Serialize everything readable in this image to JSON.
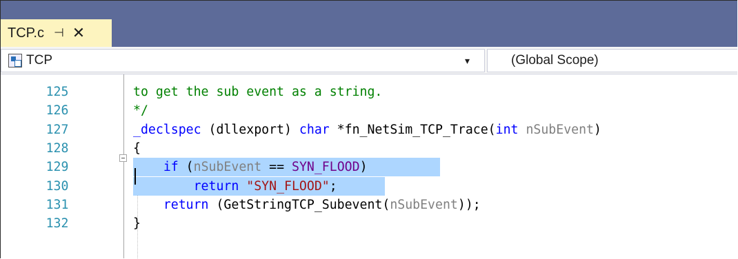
{
  "tab": {
    "title": "TCP.c",
    "pin_glyph": "⊣",
    "close_glyph": "✕"
  },
  "navbar": {
    "project": "TCP",
    "scope": "(Global Scope)",
    "arrow": "▾"
  },
  "editor": {
    "lines": [
      {
        "num": "125",
        "tokens": [
          {
            "text": "to get the sub event as a string.",
            "cls": "cm"
          }
        ]
      },
      {
        "num": "126",
        "tokens": [
          {
            "text": "*/",
            "cls": "cm"
          }
        ]
      },
      {
        "num": "127",
        "tokens": [
          {
            "text": "_declspec",
            "cls": "kw"
          },
          {
            "text": " (dllexport) ",
            "cls": ""
          },
          {
            "text": "char",
            "cls": "kw"
          },
          {
            "text": " *fn_NetSim_TCP_Trace(",
            "cls": ""
          },
          {
            "text": "int",
            "cls": "kw"
          },
          {
            "text": " ",
            "cls": ""
          },
          {
            "text": "nSubEvent",
            "cls": "param"
          },
          {
            "text": ")",
            "cls": ""
          }
        ]
      },
      {
        "num": "128",
        "tokens": [
          {
            "text": "{",
            "cls": ""
          }
        ]
      },
      {
        "num": "129",
        "tokens": [
          {
            "text": "    ",
            "cls": ""
          },
          {
            "text": "if",
            "cls": "kw"
          },
          {
            "text": " (",
            "cls": ""
          },
          {
            "text": "nSubEvent",
            "cls": "param"
          },
          {
            "text": " == ",
            "cls": ""
          },
          {
            "text": "SYN_FLOOD",
            "cls": "macro"
          },
          {
            "text": ")",
            "cls": ""
          }
        ]
      },
      {
        "num": "130",
        "tokens": [
          {
            "text": "        ",
            "cls": ""
          },
          {
            "text": "return",
            "cls": "kw"
          },
          {
            "text": " ",
            "cls": ""
          },
          {
            "text": "\"SYN_FLOOD\"",
            "cls": "str"
          },
          {
            "text": ";",
            "cls": ""
          }
        ]
      },
      {
        "num": "131",
        "tokens": [
          {
            "text": "    ",
            "cls": ""
          },
          {
            "text": "return",
            "cls": "kw"
          },
          {
            "text": " (GetStringTCP_Subevent(",
            "cls": ""
          },
          {
            "text": "nSubEvent",
            "cls": "param"
          },
          {
            "text": "));",
            "cls": ""
          }
        ]
      },
      {
        "num": "132",
        "tokens": [
          {
            "text": "}",
            "cls": ""
          }
        ]
      }
    ]
  }
}
